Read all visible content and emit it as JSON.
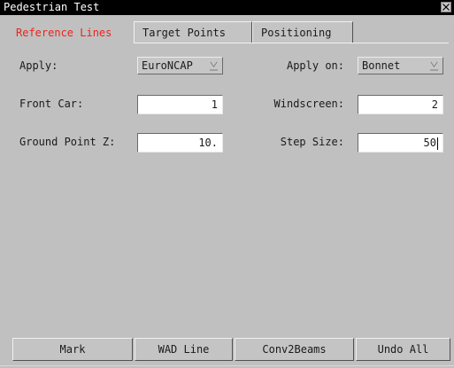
{
  "window": {
    "title": "Pedestrian Test"
  },
  "tabs": [
    {
      "label": "Reference Lines",
      "active": true
    },
    {
      "label": "Target Points",
      "active": false
    },
    {
      "label": "Positioning",
      "active": false
    }
  ],
  "form": {
    "apply_label": "Apply:",
    "apply_value": "EuroNCAP",
    "apply_on_label": "Apply on:",
    "apply_on_value": "Bonnet",
    "front_car_label": "Front Car:",
    "front_car_value": "1",
    "windscreen_label": "Windscreen:",
    "windscreen_value": "2",
    "ground_point_z_label": "Ground Point Z:",
    "ground_point_z_value": "10.",
    "step_size_label": "Step Size:",
    "step_size_value": "50"
  },
  "buttons": {
    "mark": "Mark",
    "wad_line": "WAD Line",
    "conv2beams": "Conv2Beams",
    "undo_all": "Undo All"
  },
  "colors": {
    "active_tab_text": "#e8261c",
    "background": "#c0c0c0",
    "titlebar": "#000000"
  },
  "icons": {
    "close": "close-icon",
    "dropdown": "dropdown-arrow-icon"
  }
}
